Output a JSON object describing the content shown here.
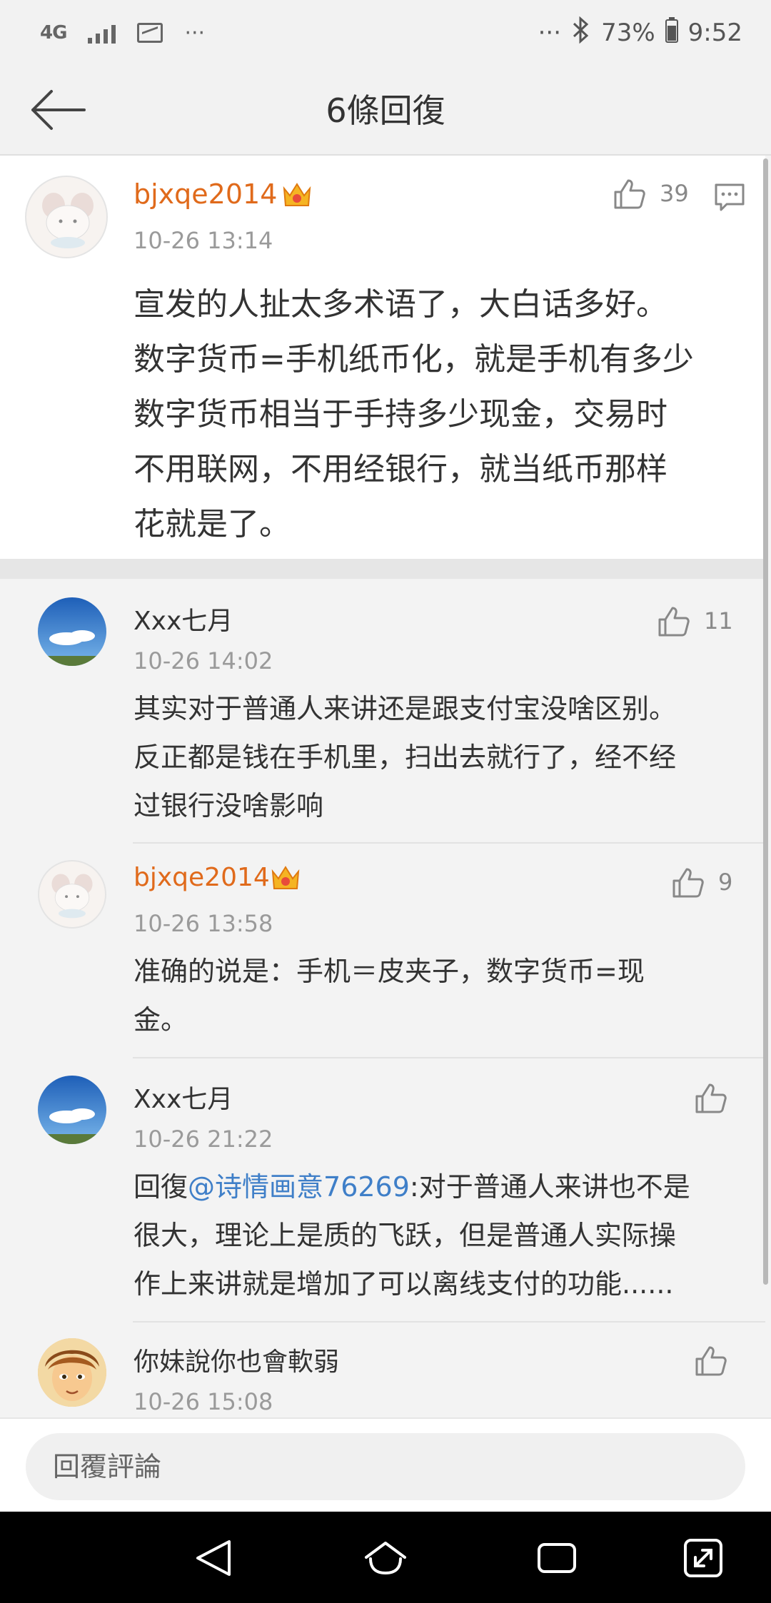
{
  "status_bar": {
    "network": "4G",
    "right_dots": "···",
    "left_dots": "···",
    "battery": "73%",
    "time": "9:52"
  },
  "header": {
    "title": "6條回復"
  },
  "main_comment": {
    "username": "bjxqe2014",
    "time": "10-26 13:14",
    "likes": "39",
    "lines": [
      "宣发的人扯太多术语了，大白话多好。",
      "数字货币=手机纸币化，就是手机有多少",
      "数字货币相当于手持多少现金，交易时",
      "不用联网，不用经银行，就当纸币那样",
      "花就是了。"
    ]
  },
  "replies": [
    {
      "username": "Xxx七月",
      "time": "10-26 14:02",
      "likes": "11",
      "lines": [
        "其实对于普通人来讲还是跟支付宝没啥区别。",
        "反正都是钱在手机里，扫出去就行了，经不经",
        "过银行没啥影响"
      ]
    },
    {
      "username": "bjxqe2014",
      "time": "10-26 13:58",
      "likes": "9",
      "lines": [
        "准确的说是：手机＝皮夹子，数字货币=现",
        "金。"
      ]
    },
    {
      "username": "Xxx七月",
      "time": "10-26 21:22",
      "likes": "",
      "reply_prefix": "回復",
      "mention": "@诗情画意76269",
      "first_rest": ":对于普通人来讲也不是",
      "lines": [
        "很大，理论上是质的飞跃，但是普通人实际操",
        "作上来讲就是增加了可以离线支付的功能......"
      ]
    },
    {
      "username": "你妹說你也會軟弱",
      "time": "10-26 15:08",
      "likes": ""
    }
  ],
  "input": {
    "placeholder": "回覆評論"
  }
}
